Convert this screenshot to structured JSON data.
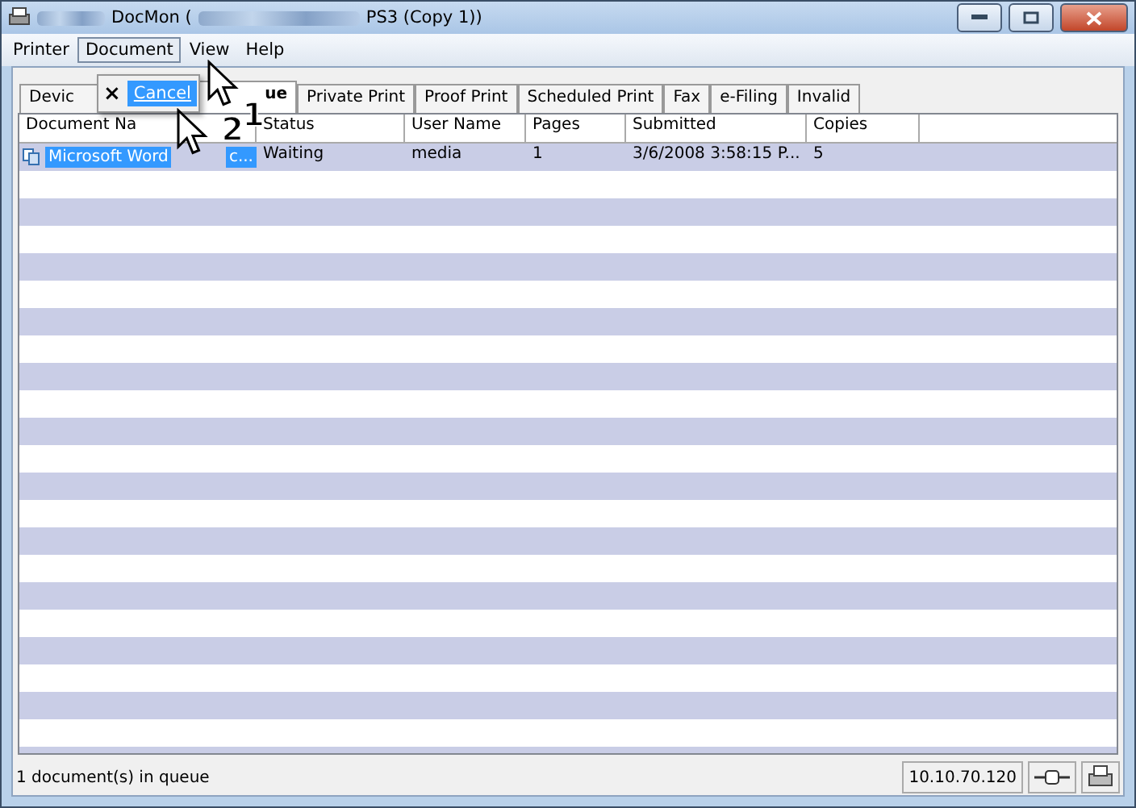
{
  "window": {
    "title_start": "DocMon (",
    "title_end": "PS3 (Copy 1))"
  },
  "menu": [
    {
      "label": "Printer",
      "selected": false
    },
    {
      "label": "Document",
      "selected": true
    },
    {
      "label": "View",
      "selected": false
    },
    {
      "label": "Help",
      "selected": false
    }
  ],
  "dropdown": {
    "items": [
      {
        "icon": "×",
        "label": "Cancel",
        "selected": true
      }
    ]
  },
  "tabs": [
    {
      "label": "Devic",
      "selected": false
    },
    {
      "label": "ue",
      "selected": true
    },
    {
      "label": "Private Print",
      "selected": false
    },
    {
      "label": "Proof Print",
      "selected": false
    },
    {
      "label": "Scheduled Print",
      "selected": false
    },
    {
      "label": "Fax",
      "selected": false
    },
    {
      "label": "e-Filing",
      "selected": false
    },
    {
      "label": "Invalid",
      "selected": false
    }
  ],
  "table": {
    "columns": [
      "Document Na",
      "Status",
      "User Name",
      "Pages",
      "Submitted",
      "Copies"
    ],
    "rows": [
      {
        "selected": true,
        "cells": [
          "Microsoft Word",
          "Waiting",
          "media",
          "1",
          "3/6/2008 3:58:15 P...",
          "5"
        ],
        "name_tail": "c..."
      }
    ]
  },
  "callouts": [
    "1",
    "2"
  ],
  "status_bar": {
    "text": "1 document(s) in queue",
    "address": "10.10.70.120"
  }
}
